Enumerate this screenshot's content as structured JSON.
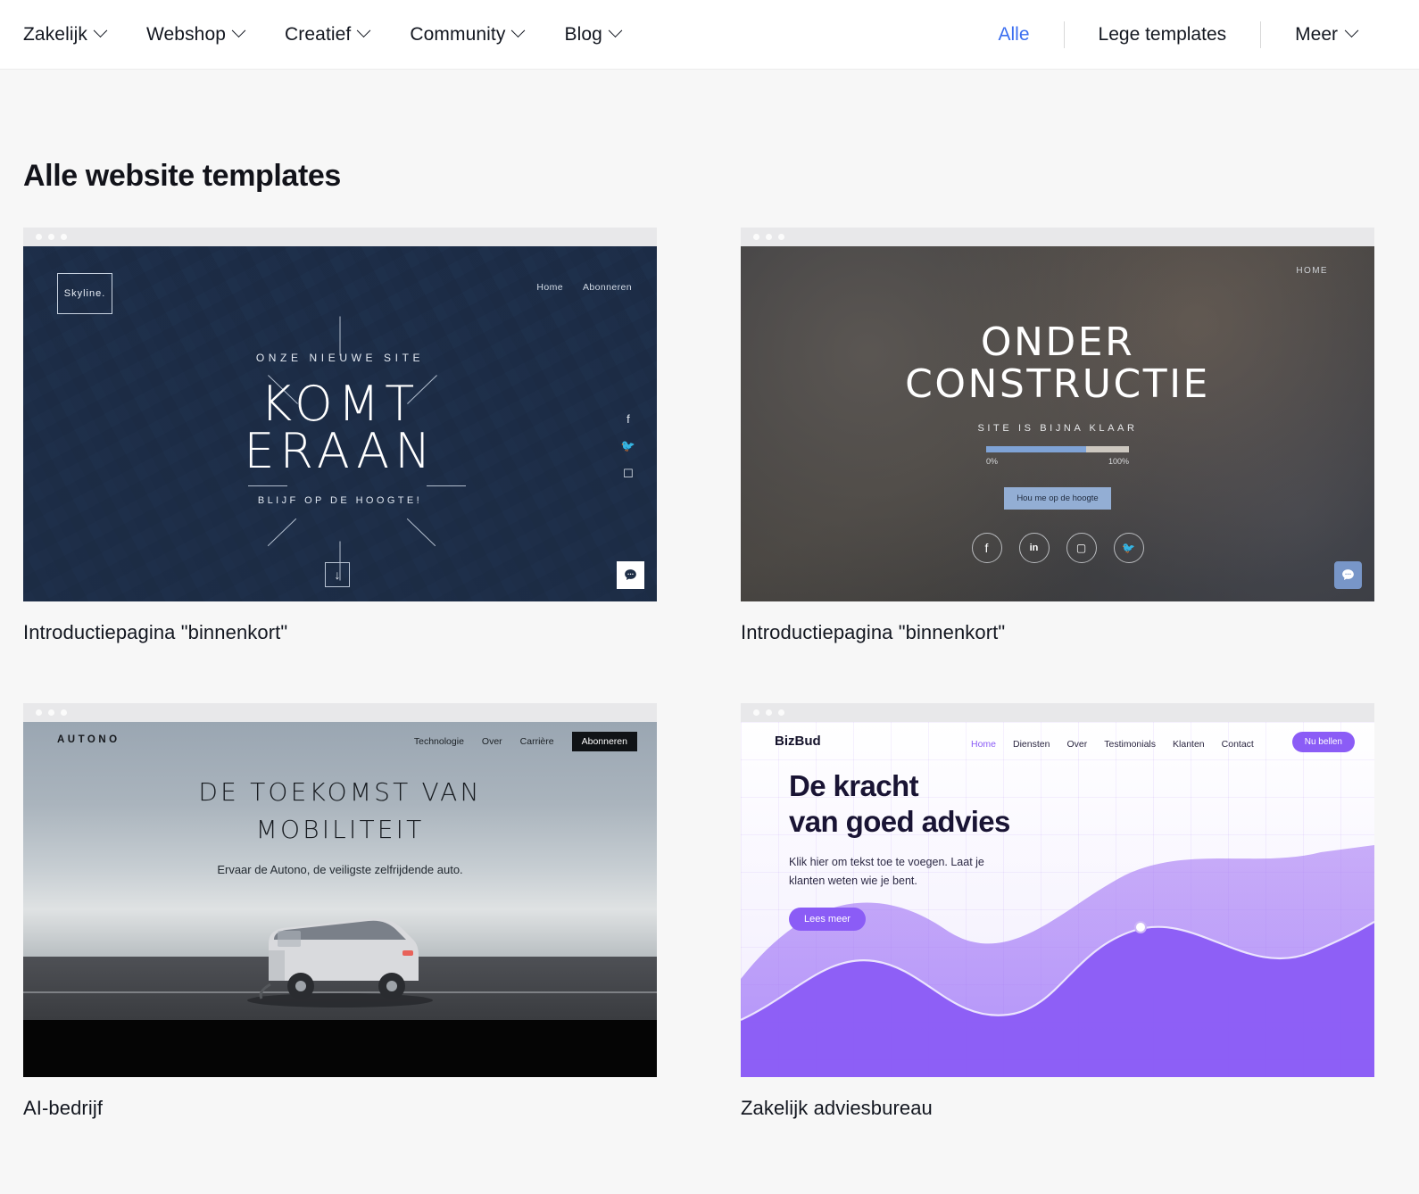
{
  "nav": {
    "left": [
      {
        "label": "Zakelijk",
        "icon": "chevron-down-icon"
      },
      {
        "label": "Webshop",
        "icon": "chevron-down-icon"
      },
      {
        "label": "Creatief",
        "icon": "chevron-down-icon"
      },
      {
        "label": "Community",
        "icon": "chevron-down-icon"
      },
      {
        "label": "Blog",
        "icon": "chevron-down-icon"
      }
    ],
    "right": {
      "all": "Alle",
      "blank": "Lege templates",
      "more": "Meer"
    },
    "active_color": "#3b6ef0"
  },
  "page": {
    "title": "Alle website templates"
  },
  "cards": [
    {
      "caption": "Introductiepagina \"binnenkort\"",
      "preview": {
        "logo": "Skyline.",
        "nav": [
          "Home",
          "Abonneren"
        ],
        "kicker": "ONZE NIEUWE SITE",
        "headline_line1": "KOMT",
        "headline_line2": "ERAAN",
        "subtitle": "BLIJF OP DE HOOGTE!",
        "social": [
          "facebook-icon",
          "twitter-icon",
          "instagram-icon"
        ],
        "scroll_icon": "arrow-down-icon",
        "chat_icon": "chat-bubble-icon"
      }
    },
    {
      "caption": "Introductiepagina \"binnenkort\"",
      "preview": {
        "nav": [
          "HOME"
        ],
        "headline_line1": "ONDER",
        "headline_line2": "CONSTRUCTIE",
        "subtitle": "SITE IS BIJNA KLAAR",
        "progress": {
          "value": 70,
          "min_label": "0%",
          "max_label": "100%"
        },
        "cta": "Hou me op de hoogte",
        "social": [
          "facebook-icon",
          "linkedin-icon",
          "instagram-icon",
          "twitter-icon"
        ],
        "chat_icon": "chat-bubble-icon"
      }
    },
    {
      "caption": "AI-bedrijf",
      "preview": {
        "logo": "AUTONO",
        "nav": [
          "Technologie",
          "Over",
          "Carrière"
        ],
        "cta": "Abonneren",
        "headline_line1": "DE TOEKOMST VAN",
        "headline_line2": "MOBILITEIT",
        "subtitle": "Ervaar de Autono, de veiligste zelfrijdende auto."
      }
    },
    {
      "caption": "Zakelijk adviesbureau",
      "preview": {
        "logo": "BizBud",
        "nav": [
          "Home",
          "Diensten",
          "Over",
          "Testimonials",
          "Klanten",
          "Contact"
        ],
        "active_nav": "Home",
        "cta": "Nu bellen",
        "headline_line1": "De kracht",
        "headline_line2": "van goed advies",
        "text_line1": "Klik hier om tekst toe te voegen. Laat je",
        "text_line2": "klanten weten wie je bent.",
        "button": "Lees meer",
        "accent": "#8b5cf6"
      }
    }
  ]
}
